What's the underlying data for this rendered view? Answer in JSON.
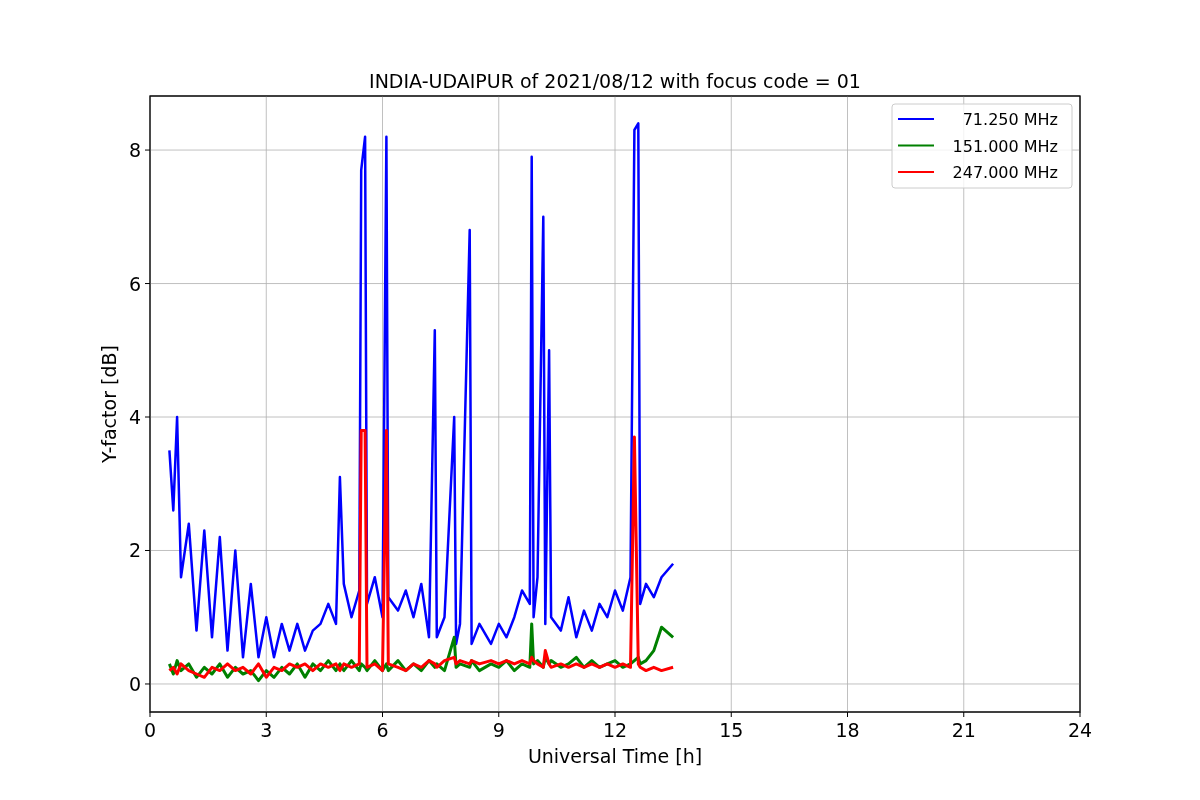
{
  "figure": {
    "chart_data": {
      "type": "line",
      "grid": true,
      "legend": "upper right",
      "title": "INDIA-UDAIPUR of 2021/08/12 with focus code = 01",
      "xlabel": "Universal Time [h]",
      "ylabel": "Y-factor [dB]",
      "xlim": [
        0,
        24
      ],
      "ylim": [
        -0.42,
        8.81
      ],
      "xticks": [
        0,
        3,
        6,
        9,
        12,
        15,
        18,
        21,
        24
      ],
      "yticks": [
        0,
        2,
        4,
        6,
        8
      ],
      "x": [
        0.5,
        0.6,
        0.7,
        0.8,
        1.0,
        1.2,
        1.4,
        1.6,
        1.8,
        2.0,
        2.2,
        2.4,
        2.6,
        2.8,
        3.0,
        3.2,
        3.4,
        3.6,
        3.8,
        4.0,
        4.2,
        4.4,
        4.6,
        4.8,
        4.9,
        5.0,
        5.2,
        5.4,
        5.45,
        5.55,
        5.6,
        5.8,
        6.0,
        6.1,
        6.15,
        6.4,
        6.6,
        6.8,
        7.0,
        7.2,
        7.35,
        7.4,
        7.6,
        7.85,
        7.9,
        8.0,
        8.25,
        8.3,
        8.5,
        8.8,
        9.0,
        9.2,
        9.4,
        9.6,
        9.8,
        9.85,
        9.9,
        10.0,
        10.15,
        10.2,
        10.3,
        10.35,
        10.6,
        10.8,
        11.0,
        11.2,
        11.4,
        11.6,
        11.8,
        12.0,
        12.2,
        12.4,
        12.5,
        12.6,
        12.65,
        12.8,
        13.0,
        13.2,
        13.5
      ],
      "series": [
        {
          "name": "71.250 MHz",
          "color": "#0000ff",
          "values": [
            3.5,
            2.6,
            4.0,
            1.6,
            2.4,
            0.8,
            2.3,
            0.7,
            2.2,
            0.5,
            2.0,
            0.4,
            1.5,
            0.4,
            1.0,
            0.4,
            0.9,
            0.5,
            0.9,
            0.5,
            0.8,
            0.9,
            1.2,
            0.9,
            3.1,
            1.5,
            1.0,
            1.4,
            7.7,
            8.2,
            1.2,
            1.6,
            1.0,
            8.2,
            1.3,
            1.1,
            1.4,
            1.0,
            1.5,
            0.7,
            5.3,
            0.7,
            1.0,
            4.0,
            0.6,
            0.9,
            6.8,
            0.6,
            0.9,
            0.6,
            0.9,
            0.7,
            1.0,
            1.4,
            1.2,
            7.9,
            1.0,
            1.6,
            7.0,
            0.9,
            5.0,
            1.0,
            0.8,
            1.3,
            0.7,
            1.1,
            0.8,
            1.2,
            1.0,
            1.4,
            1.1,
            1.6,
            8.3,
            8.4,
            1.2,
            1.5,
            1.3,
            1.6,
            1.8
          ]
        },
        {
          "name": "151.000 MHz",
          "color": "#008000",
          "values": [
            0.3,
            0.15,
            0.35,
            0.2,
            0.3,
            0.1,
            0.25,
            0.15,
            0.3,
            0.1,
            0.25,
            0.15,
            0.2,
            0.05,
            0.2,
            0.1,
            0.25,
            0.15,
            0.3,
            0.1,
            0.3,
            0.2,
            0.35,
            0.2,
            0.3,
            0.2,
            0.35,
            0.2,
            0.3,
            0.25,
            0.2,
            0.35,
            0.2,
            0.3,
            0.2,
            0.35,
            0.2,
            0.3,
            0.2,
            0.35,
            0.25,
            0.3,
            0.2,
            0.7,
            0.25,
            0.3,
            0.25,
            0.35,
            0.2,
            0.3,
            0.25,
            0.35,
            0.2,
            0.3,
            0.25,
            0.9,
            0.3,
            0.35,
            0.25,
            0.4,
            0.3,
            0.35,
            0.25,
            0.3,
            0.4,
            0.25,
            0.35,
            0.25,
            0.3,
            0.35,
            0.25,
            0.3,
            0.35,
            0.4,
            0.3,
            0.35,
            0.5,
            0.85,
            0.7
          ]
        },
        {
          "name": "247.000 MHz",
          "color": "#ff0000",
          "values": [
            0.2,
            0.25,
            0.15,
            0.3,
            0.2,
            0.15,
            0.1,
            0.25,
            0.2,
            0.3,
            0.2,
            0.25,
            0.15,
            0.3,
            0.1,
            0.25,
            0.2,
            0.3,
            0.25,
            0.3,
            0.2,
            0.3,
            0.25,
            0.3,
            0.2,
            0.3,
            0.25,
            0.3,
            3.8,
            3.8,
            0.25,
            0.3,
            0.2,
            3.8,
            0.3,
            0.25,
            0.2,
            0.3,
            0.25,
            0.35,
            0.3,
            0.25,
            0.35,
            0.4,
            0.3,
            0.35,
            0.3,
            0.35,
            0.3,
            0.35,
            0.3,
            0.35,
            0.3,
            0.35,
            0.3,
            0.4,
            0.35,
            0.3,
            0.25,
            0.5,
            0.3,
            0.25,
            0.3,
            0.25,
            0.3,
            0.25,
            0.3,
            0.25,
            0.3,
            0.25,
            0.3,
            0.25,
            3.7,
            0.3,
            0.25,
            0.2,
            0.25,
            0.2,
            0.25
          ]
        }
      ]
    }
  }
}
